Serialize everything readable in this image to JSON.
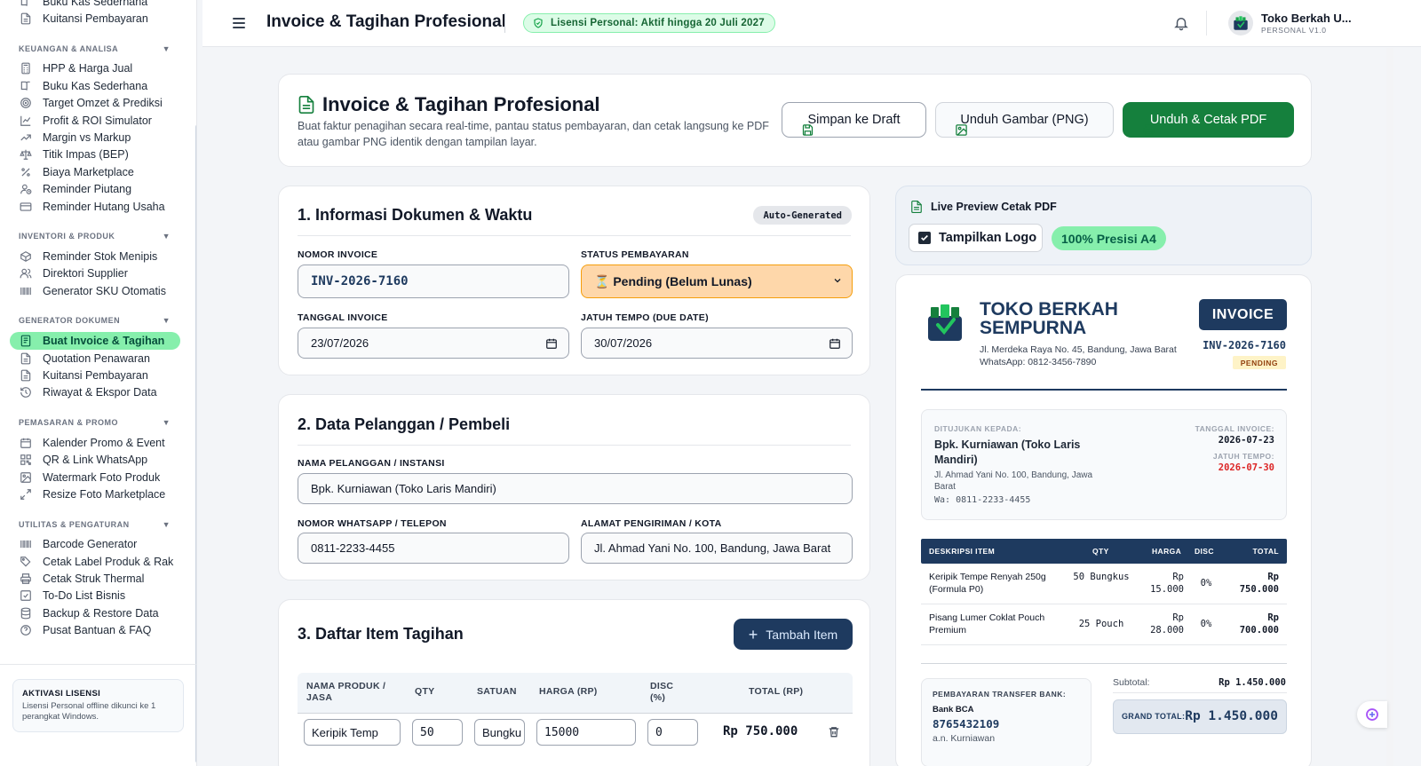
{
  "sidebar": {
    "top_items": [
      {
        "label": "Buku Kas Sederhana",
        "icon": "book-icon"
      },
      {
        "label": "Kuitansi Pembayaran",
        "icon": "document-icon"
      }
    ],
    "groups": [
      {
        "title": "KEUANGAN & ANALISA",
        "items": [
          {
            "label": "HPP & Harga Jual",
            "icon": "calculator-icon"
          },
          {
            "label": "Buku Kas Sederhana",
            "icon": "book-icon"
          },
          {
            "label": "Target Omzet & Prediksi",
            "icon": "target-icon"
          },
          {
            "label": "Profit & ROI Simulator",
            "icon": "line-chart-icon"
          },
          {
            "label": "Margin vs Markup",
            "icon": "trend-icon"
          },
          {
            "label": "Titik Impas (BEP)",
            "icon": "scale-icon"
          },
          {
            "label": "Biaya Marketplace",
            "icon": "percent-icon"
          },
          {
            "label": "Reminder Piutang",
            "icon": "user-clock-icon"
          },
          {
            "label": "Reminder Hutang Usaha",
            "icon": "card-icon"
          }
        ]
      },
      {
        "title": "INVENTORI & PRODUK",
        "items": [
          {
            "label": "Reminder Stok Menipis",
            "icon": "box-icon"
          },
          {
            "label": "Direktori Supplier",
            "icon": "users-icon"
          },
          {
            "label": "Generator SKU Otomatis",
            "icon": "barcode-icon"
          }
        ]
      },
      {
        "title": "GENERATOR DOKUMEN",
        "items": [
          {
            "label": "Buat Invoice & Tagihan",
            "icon": "invoice-icon",
            "active": true
          },
          {
            "label": "Quotation Penawaran",
            "icon": "document-icon"
          },
          {
            "label": "Kuitansi Pembayaran",
            "icon": "document-icon"
          },
          {
            "label": "Riwayat & Ekspor Data",
            "icon": "history-icon"
          }
        ]
      },
      {
        "title": "PEMASARAN & PROMO",
        "items": [
          {
            "label": "Kalender Promo & Event",
            "icon": "calendar-icon"
          },
          {
            "label": "QR & Link WhatsApp",
            "icon": "qr-icon"
          },
          {
            "label": "Watermark Foto Produk",
            "icon": "image-icon"
          },
          {
            "label": "Resize Foto Marketplace",
            "icon": "resize-icon"
          }
        ]
      },
      {
        "title": "UTILITAS & PENGATURAN",
        "items": [
          {
            "label": "Barcode Generator",
            "icon": "barcode-icon"
          },
          {
            "label": "Cetak Label Produk & Rak",
            "icon": "tag-icon"
          },
          {
            "label": "Cetak Struk Thermal",
            "icon": "printer-icon"
          },
          {
            "label": "To-Do List Bisnis",
            "icon": "checkbox-icon"
          },
          {
            "label": "Backup & Restore Data",
            "icon": "database-icon"
          },
          {
            "label": "Pusat Bantuan & FAQ",
            "icon": "help-icon"
          }
        ]
      }
    ],
    "license": {
      "title": "AKTIVASI LISENSI",
      "desc": "Lisensi Personal offline dikunci ke 1 perangkat Windows."
    }
  },
  "header": {
    "title": "Invoice & Tagihan Profesional",
    "license_badge": "Lisensi Personal: Aktif hingga 20 Juli 2027",
    "user_name": "Toko Berkah U...",
    "user_sub": "PERSONAL V1.0"
  },
  "hero": {
    "title": "Invoice & Tagihan Profesional",
    "desc": "Buat faktur penagihan secara real-time, pantau status pembayaran, dan cetak langsung ke PDF atau gambar PNG identik dengan tampilan layar.",
    "btn_draft": "Simpan ke Draft",
    "btn_png": "Unduh Gambar (PNG)",
    "btn_pdf": "Unduh & Cetak PDF"
  },
  "section1": {
    "title": "1. Informasi Dokumen & Waktu",
    "badge": "Auto-Generated",
    "invoice_no_label": "NOMOR INVOICE",
    "invoice_no": "INV-2026-7160",
    "status_label": "STATUS PEMBAYARAN",
    "status": "⏳ Pending (Belum Lunas)",
    "date_label": "TANGGAL INVOICE",
    "date": "23/07/2026",
    "due_label": "JATUH TEMPO (DUE DATE)",
    "due": "30/07/2026"
  },
  "section2": {
    "title": "2. Data Pelanggan / Pembeli",
    "name_label": "NAMA PELANGGAN / INSTANSI",
    "name": "Bpk. Kurniawan (Toko Laris Mandiri)",
    "phone_label": "NOMOR WHATSAPP / TELEPON",
    "phone": "0811-2233-4455",
    "address_label": "ALAMAT PENGIRIMAN / KOTA",
    "address": "Jl. Ahmad Yani No. 100, Bandung, Jawa Barat"
  },
  "section3": {
    "title": "3. Daftar Item Tagihan",
    "add_btn": "Tambah Item",
    "columns": [
      "NAMA PRODUK / JASA",
      "QTY",
      "SATUAN",
      "HARGA (RP)",
      "DISC (%)",
      "TOTAL (RP)"
    ],
    "row": {
      "name": "Keripik Temp",
      "qty": "50",
      "unit": "Bungku",
      "price": "15000",
      "disc": "0",
      "total": "Rp 750.000"
    }
  },
  "preview": {
    "title": "Live Preview Cetak PDF",
    "show_logo": "Tampilkan Logo",
    "precision": "100% Presisi A4",
    "store_name": "TOKO BERKAH SEMPURNA",
    "store_address": "Jl. Merdeka Raya No. 45, Bandung, Jawa Barat",
    "store_phone": "WhatsApp: 0812-3456-7890",
    "doc_type": "INVOICE",
    "doc_no": "INV-2026-7160",
    "status": "PENDING",
    "to_label": "DITUJUKAN KEPADA:",
    "to_name": "Bpk. Kurniawan (Toko Laris Mandiri)",
    "to_address": "Jl. Ahmad Yani No. 100, Bandung, Jawa Barat",
    "to_phone": "Wa: 0811-2233-4455",
    "date_label": "TANGGAL INVOICE:",
    "date": "2026-07-23",
    "due_label": "JATUH TEMPO:",
    "due": "2026-07-30",
    "columns": [
      "DESKRIPSI ITEM",
      "QTY",
      "HARGA",
      "DISC",
      "TOTAL"
    ],
    "items": [
      {
        "desc": "Keripik Tempe Renyah 250g (Formula P0)",
        "qty": "50 Bungkus",
        "price": "Rp 15.000",
        "disc": "0%",
        "total": "Rp 750.000"
      },
      {
        "desc": "Pisang Lumer Coklat Pouch Premium",
        "qty": "25 Pouch",
        "price": "Rp 28.000",
        "disc": "0%",
        "total": "Rp 700.000"
      }
    ],
    "pay_label": "PEMBAYARAN TRANSFER BANK:",
    "bank": "Bank BCA",
    "account": "8765432109",
    "holder": "a.n. Kurniawan",
    "subtotal_label": "Subtotal:",
    "subtotal": "Rp 1.450.000",
    "grand_label": "GRAND TOTAL:",
    "grand": "Rp 1.450.000"
  },
  "colors": {
    "brand_green": "#15803d",
    "navy": "#1e3a5f",
    "pending": "#fed7aa",
    "due_red": "#dc2626"
  }
}
